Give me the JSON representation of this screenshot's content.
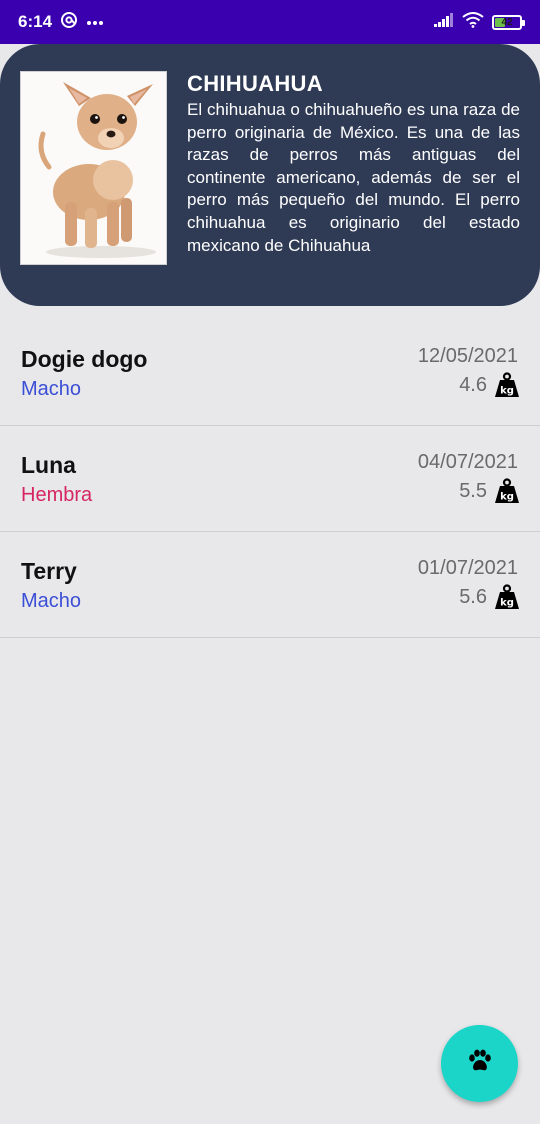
{
  "status_bar": {
    "time": "6:14",
    "battery_level": "42",
    "battery_fraction": 0.42
  },
  "breed": {
    "title": "CHIHUAHUA",
    "description": "El chihuahua o chihuahueño es una raza de perro originaria de México. Es una de las razas de perros más antiguas del continente americano, además de ser el perro más pequeño del mundo. El perro chihuahua es originario del estado mexicano de Chihuahua"
  },
  "dogs": [
    {
      "name": "Dogie dogo",
      "sex": "Macho",
      "date": "12/05/2021",
      "weight": "4.6"
    },
    {
      "name": "Luna",
      "sex": "Hembra",
      "date": "04/07/2021",
      "weight": "5.5"
    },
    {
      "name": "Terry",
      "sex": "Macho",
      "date": "01/07/2021",
      "weight": "5.6"
    }
  ],
  "icons": {
    "weight": "kg-weight-icon",
    "fab": "paw-icon"
  },
  "colors": {
    "status_bar": "#3a00b0",
    "header_card": "#2f3a55",
    "macho": "#3b4fd6",
    "hembra": "#d6265f",
    "fab": "#1bd6c8"
  }
}
